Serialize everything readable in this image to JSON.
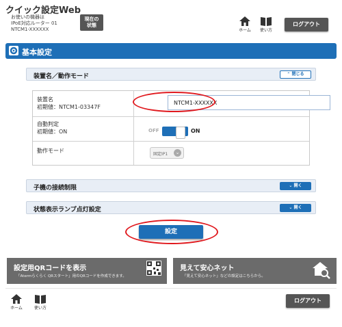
{
  "header": {
    "app_title": "クイック設定Web",
    "device_line1": "お使いの機器は",
    "device_line2": "IPoE対応ルーター 01",
    "device_line3": "NTCM1-XXXXXX",
    "status_button_line1": "現在の",
    "status_button_line2": "状態",
    "home_label": "ホーム",
    "manual_label": "使い方",
    "logout_label": "ログアウト"
  },
  "section": {
    "title": "基本設定"
  },
  "accordions": {
    "device_mode": {
      "label": "装置名／動作モード",
      "toggle": "閉じる",
      "expanded": true
    },
    "child_limit": {
      "label": "子機の接続制限",
      "toggle": "開く",
      "expanded": false
    },
    "lamp": {
      "label": "状態表示ランプ点灯設定",
      "toggle": "開く",
      "expanded": false
    }
  },
  "settings": {
    "device_name": {
      "label": "装置名",
      "default": "初期値：NTCM1-03347F",
      "value": "NTCM1-XXXXXX"
    },
    "auto_detect": {
      "label": "自動判定",
      "default": "初期値：ON",
      "off_text": "OFF",
      "on_text": "ON",
      "state": "ON"
    },
    "mode": {
      "label": "動作モード",
      "value": "固定IP1"
    }
  },
  "set_button": "設定",
  "banners": {
    "qr": {
      "title": "設定用QRコードを表示",
      "sub": "「Atermらくらく QRスタート」用のQRコードを作成できます。"
    },
    "mieru": {
      "title": "見えて安心ネット",
      "sub": "「見えて安心ネット」などの設定はこちらから。"
    }
  },
  "footer": {
    "home_label": "ホーム",
    "manual_label": "使い方",
    "logout_label": "ログアウト"
  },
  "colors": {
    "accent": "#1e6fb7",
    "highlight": "#e0191e",
    "dark_button": "#555555"
  }
}
